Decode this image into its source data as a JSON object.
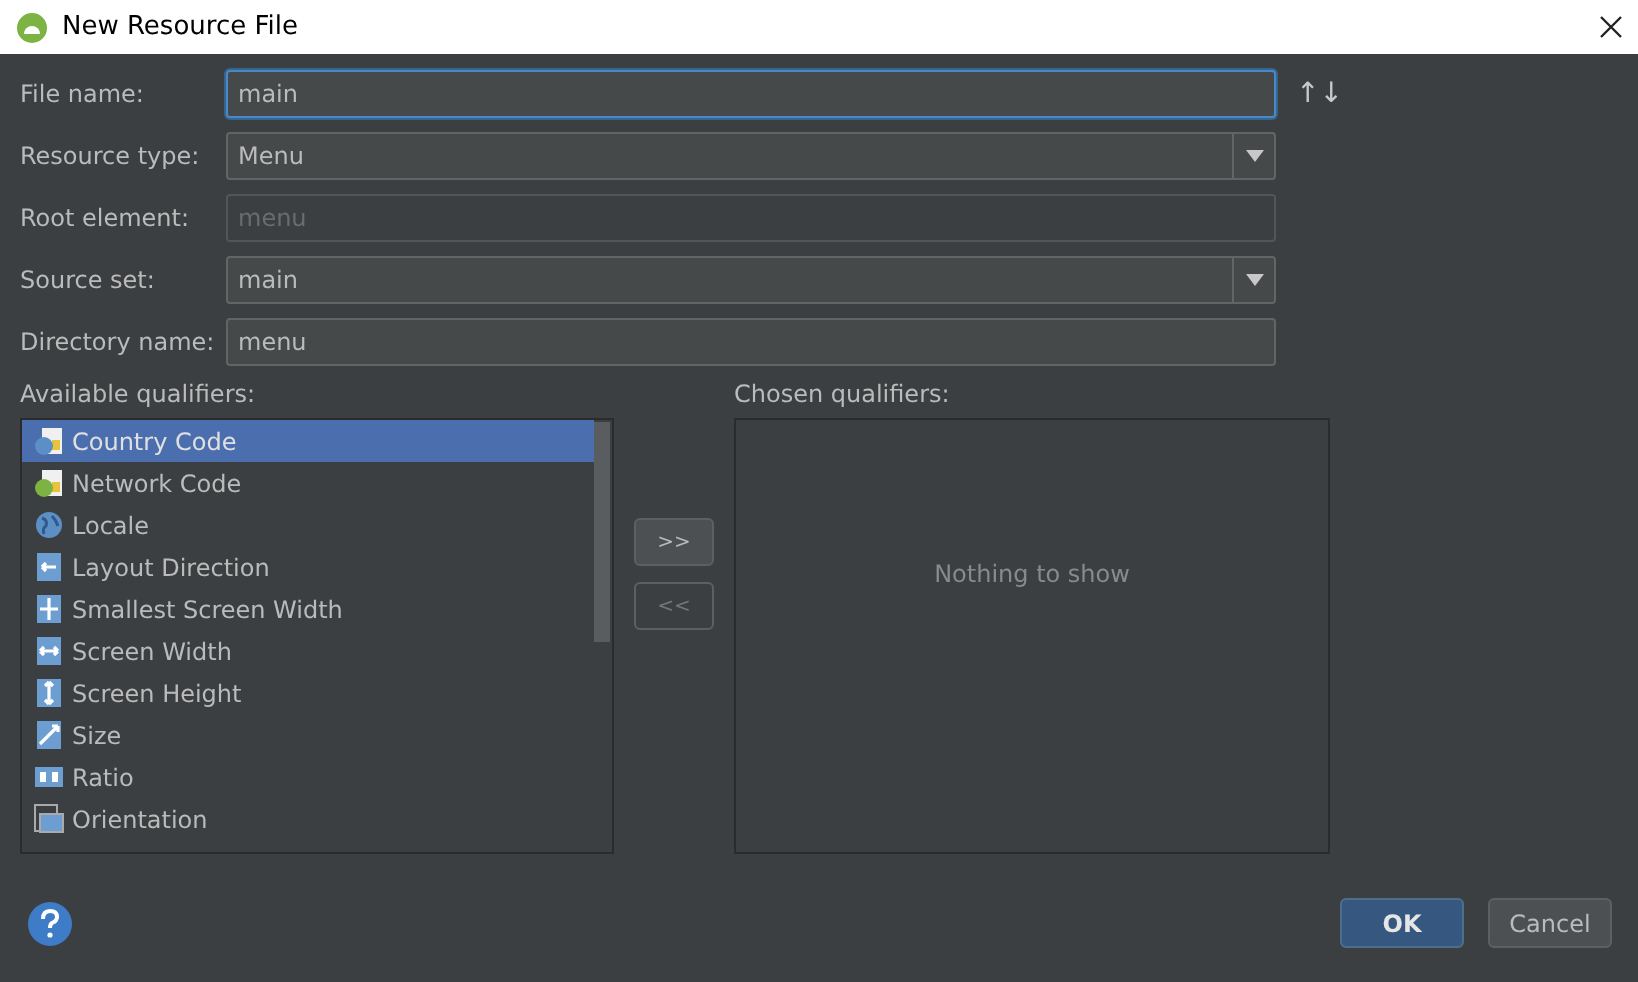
{
  "window": {
    "title": "New Resource File"
  },
  "fields": [
    {
      "label": "File name:",
      "kind": "text",
      "value": "main",
      "focused": true,
      "disabled": false
    },
    {
      "label": "Resource type:",
      "kind": "dropdown",
      "value": "Menu",
      "focused": false,
      "disabled": false
    },
    {
      "label": "Root element:",
      "kind": "text",
      "value": "menu",
      "focused": false,
      "disabled": true
    },
    {
      "label": "Source set:",
      "kind": "dropdown",
      "value": "main",
      "focused": false,
      "disabled": false
    },
    {
      "label": "Directory name:",
      "kind": "text",
      "value": "menu",
      "focused": false,
      "disabled": false
    }
  ],
  "sort_button": {
    "label": "↑↓"
  },
  "available_qualifiers": {
    "label": "Available qualifiers:",
    "items": [
      {
        "label": "Country Code",
        "selected": true
      },
      {
        "label": "Network Code",
        "selected": false
      },
      {
        "label": "Locale",
        "selected": false
      },
      {
        "label": "Layout Direction",
        "selected": false
      },
      {
        "label": "Smallest Screen Width",
        "selected": false
      },
      {
        "label": "Screen Width",
        "selected": false
      },
      {
        "label": "Screen Height",
        "selected": false
      },
      {
        "label": "Size",
        "selected": false
      },
      {
        "label": "Ratio",
        "selected": false
      },
      {
        "label": "Orientation",
        "selected": false
      }
    ]
  },
  "move_buttons": [
    {
      "label": ">>",
      "disabled": false
    },
    {
      "label": "<<",
      "disabled": true
    }
  ],
  "chosen_qualifiers": {
    "label": "Chosen qualifiers:",
    "empty_text": "Nothing to show"
  },
  "buttons": [
    {
      "label": "OK",
      "default": true
    },
    {
      "label": "Cancel",
      "default": false
    }
  ]
}
